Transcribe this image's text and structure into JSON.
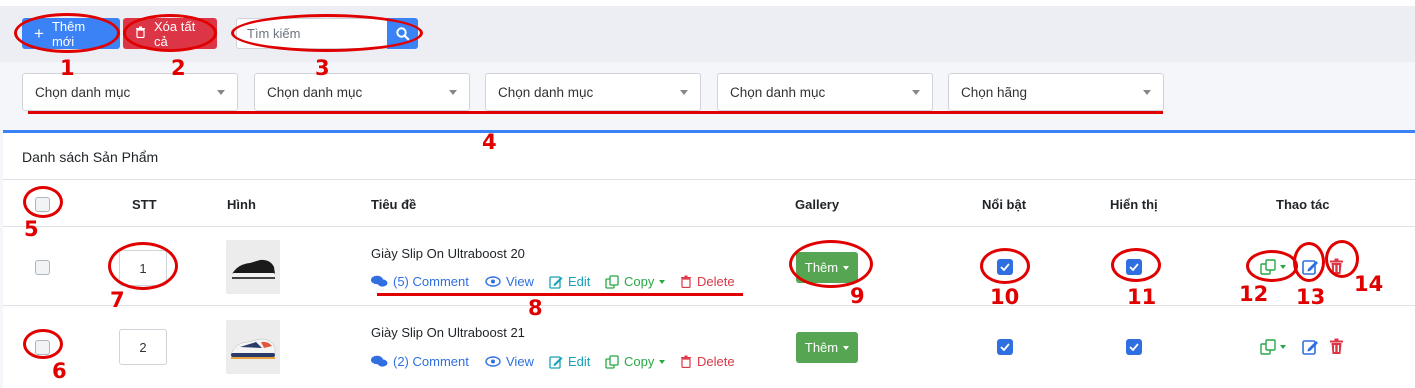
{
  "toolbar": {
    "add_label": "Thêm mới",
    "delete_all_label": "Xóa tất cả",
    "search_placeholder": "Tìm kiếm"
  },
  "filters": [
    "Chọn danh mục",
    "Chọn danh mục",
    "Chọn danh mục",
    "Chọn danh mục",
    "Chọn hãng"
  ],
  "card": {
    "title": "Danh sách Sản Phẩm",
    "columns": {
      "stt": "STT",
      "image": "Hình",
      "title": "Tiêu đề",
      "gallery": "Gallery",
      "featured": "Nổi bật",
      "visible": "Hiển thị",
      "actions": "Thao tác"
    }
  },
  "rows": [
    {
      "stt": "1",
      "title": "Giày Slip On Ultraboost 20",
      "comment_label": "(5) Comment",
      "view_label": "View",
      "edit_label": "Edit",
      "copy_label": "Copy",
      "delete_label": "Delete",
      "gallery_label": "Thêm",
      "featured": true,
      "visible": true
    },
    {
      "stt": "2",
      "title": "Giày Slip On Ultraboost 21",
      "comment_label": "(2) Comment",
      "view_label": "View",
      "edit_label": "Edit",
      "copy_label": "Copy",
      "delete_label": "Delete",
      "gallery_label": "Thêm",
      "featured": true,
      "visible": true
    }
  ],
  "annotations": [
    "1",
    "2",
    "3",
    "4",
    "5",
    "6",
    "7",
    "8",
    "9",
    "10",
    "11",
    "12",
    "13",
    "14"
  ],
  "colors": {
    "primary": "#3b82f6",
    "danger": "#dc3545",
    "success": "#28a745",
    "annotation": "#e00000"
  }
}
